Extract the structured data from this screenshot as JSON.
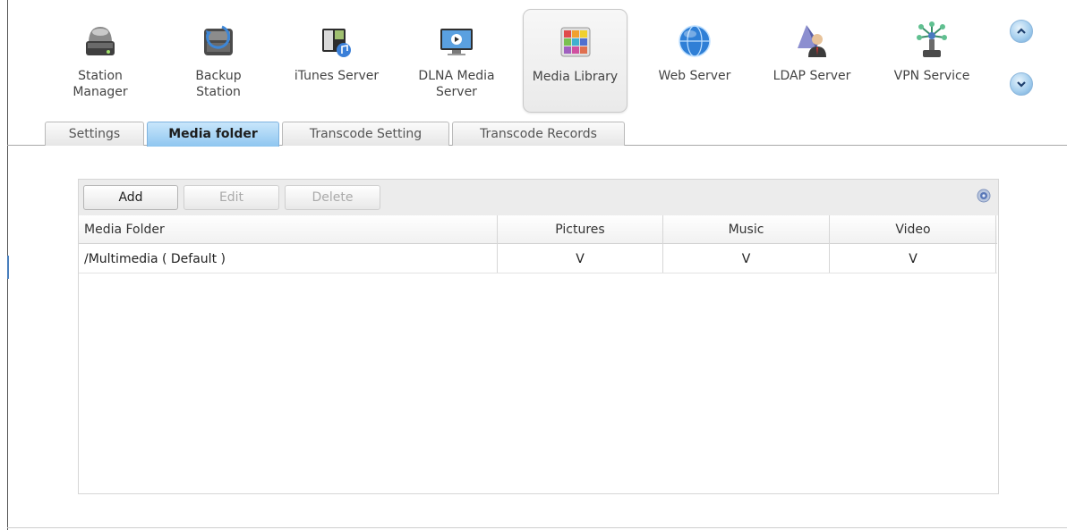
{
  "apps": [
    {
      "label": "Station\nManager",
      "icon": "station-manager-icon"
    },
    {
      "label": "Backup\nStation",
      "icon": "backup-station-icon"
    },
    {
      "label": "iTunes Server",
      "icon": "itunes-server-icon"
    },
    {
      "label": "DLNA Media\nServer",
      "icon": "dlna-media-server-icon"
    },
    {
      "label": "Media Library",
      "icon": "media-library-icon",
      "selected": true
    },
    {
      "label": "Web Server",
      "icon": "web-server-icon"
    },
    {
      "label": "LDAP Server",
      "icon": "ldap-server-icon"
    },
    {
      "label": "VPN Service",
      "icon": "vpn-service-icon"
    }
  ],
  "scroll": {
    "up_icon": "chevron-up-icon",
    "down_icon": "chevron-down-icon"
  },
  "tabs": [
    {
      "label": "Settings"
    },
    {
      "label": "Media folder",
      "active": true
    },
    {
      "label": "Transcode Setting"
    },
    {
      "label": "Transcode Records"
    }
  ],
  "toolbar": {
    "add_label": "Add",
    "edit_label": "Edit",
    "delete_label": "Delete",
    "help_icon": "help-icon"
  },
  "table": {
    "columns": [
      "Media Folder",
      "Pictures",
      "Music",
      "Video"
    ],
    "rows": [
      [
        "/Multimedia ( Default )",
        "V",
        "V",
        "V"
      ]
    ]
  },
  "colors": {
    "accent": "#8fc6f0",
    "tab_active_border": "#7fb3df",
    "toolbar_bg": "#ececec"
  }
}
